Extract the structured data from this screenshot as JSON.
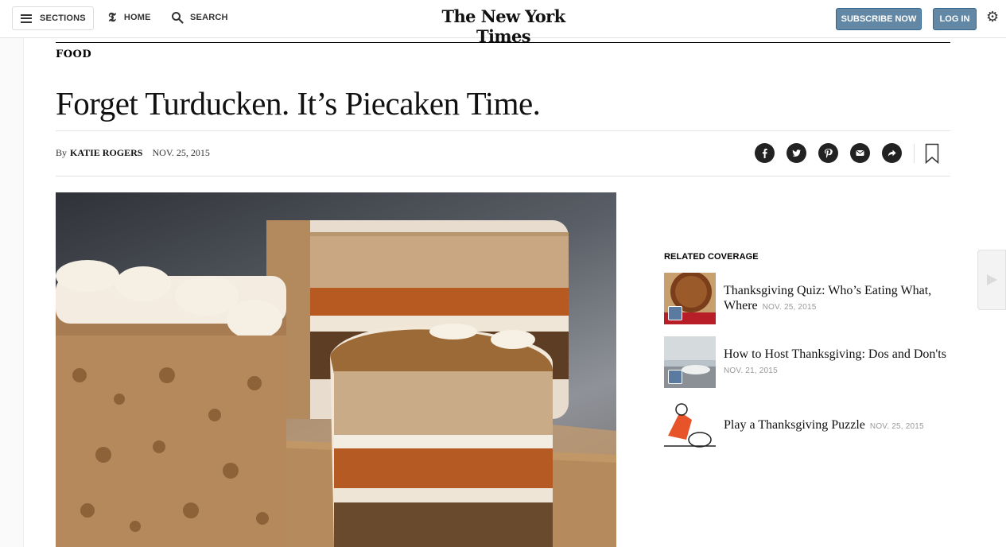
{
  "masthead": {
    "sections_label": "SECTIONS",
    "home_label": "HOME",
    "search_label": "SEARCH",
    "brand": "The New York Times",
    "subscribe_label": "SUBSCRIBE NOW",
    "login_label": "LOG IN",
    "settings_icon": "gear-icon"
  },
  "article": {
    "section": "FOOD",
    "headline": "Forget Turducken. It’s Piecaken Time.",
    "byline_prefix": "By",
    "author": "KATIE ROGERS",
    "date": "NOV. 25, 2015",
    "share_icons": [
      "facebook-icon",
      "twitter-icon",
      "pinterest-icon",
      "email-icon",
      "share-icon"
    ],
    "bookmark_icon": "bookmark-icon"
  },
  "related": {
    "title": "RELATED COVERAGE",
    "items": [
      {
        "title": "Thanksgiving Quiz: Who’s Eating What, Where",
        "date": "NOV. 25, 2015",
        "badge": "interactive-icon"
      },
      {
        "title": "How to Host Thanksgiving: Dos and Don'ts",
        "date": "NOV. 21, 2015",
        "badge": "video-icon"
      },
      {
        "title": "Play a Thanksgiving Puzzle",
        "date": "NOV. 25, 2015",
        "badge": ""
      }
    ]
  },
  "colors": {
    "button_blue": "#6288a5",
    "share_icon_bg": "#222222"
  }
}
